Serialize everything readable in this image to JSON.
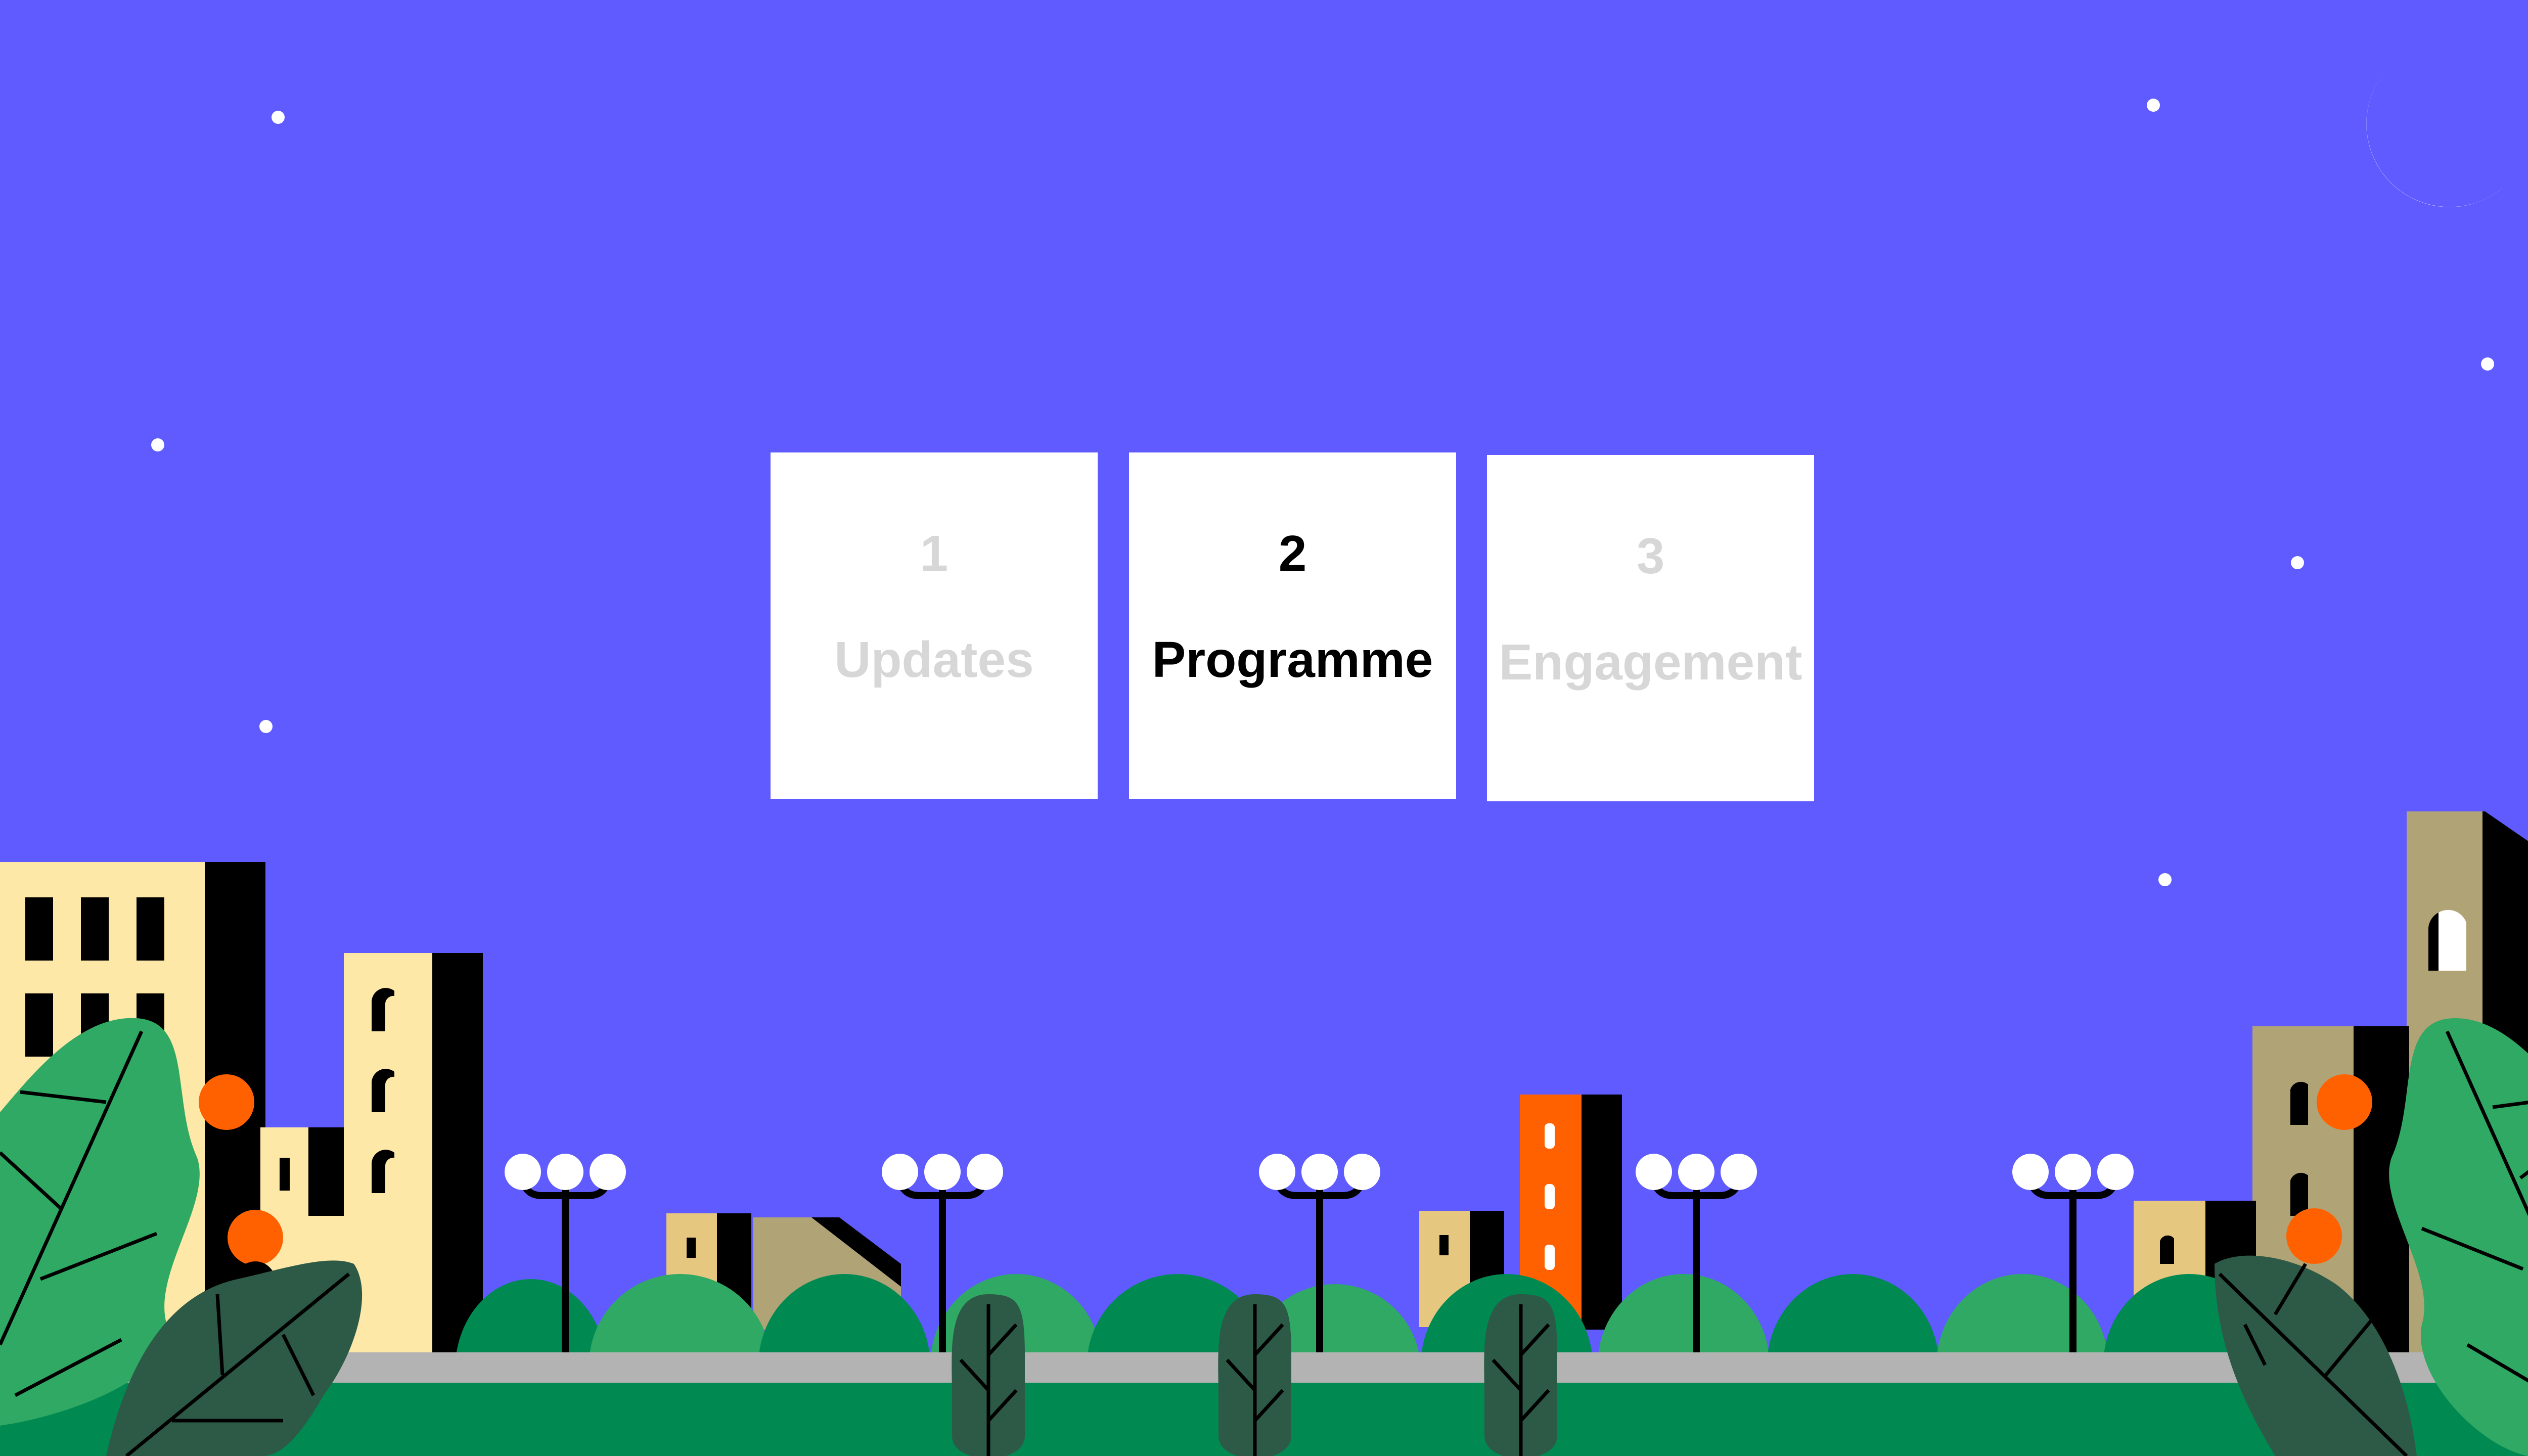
{
  "steps": [
    {
      "number": "1",
      "label": "Updates",
      "state": "inactive"
    },
    {
      "number": "2",
      "label": "Programme",
      "state": "active"
    },
    {
      "number": "3",
      "label": "Engagement",
      "state": "inactive"
    }
  ],
  "colors": {
    "sky": "#5f5bff",
    "card": "#ffffff",
    "active_text": "#000000",
    "inactive_text": "#d7d7d7",
    "grass": "#008a52",
    "path": "#b3b3b3",
    "building_cream": "#fde8a8",
    "building_tan": "#b0a375",
    "building_orange": "#ff6100",
    "foliage_light": "#2fa963",
    "foliage_dark": "#2c5a47"
  },
  "icons": {
    "moon": "crescent-moon-icon",
    "star": "star-dot-icon",
    "lamp": "street-lamp-icon"
  }
}
